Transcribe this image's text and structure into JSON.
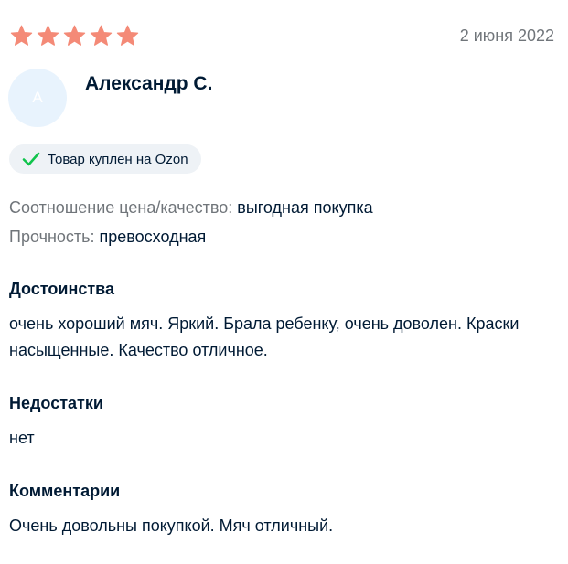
{
  "rating": {
    "value": 5,
    "max": 5,
    "color": "#f48a77"
  },
  "date": "2 июня 2022",
  "author": {
    "name": "Александр С.",
    "avatar_letter": "А"
  },
  "badge": {
    "icon": "check-icon",
    "text": "Товар куплен на Ozon",
    "icon_color": "#10c44c"
  },
  "properties": [
    {
      "label": "Соотношение цена/качество:",
      "value": "выгодная покупка"
    },
    {
      "label": "Прочность:",
      "value": "превосходная"
    }
  ],
  "sections": {
    "pros": {
      "title": "Достоинства",
      "text": "очень хороший мяч. Яркий. Брала ребенку, очень доволен. Краски насыщенные. Качество отличное."
    },
    "cons": {
      "title": "Недостатки",
      "text": "нет"
    },
    "comment": {
      "title": "Комментарии",
      "text": "Очень довольны покупкой. Мяч отличный."
    }
  }
}
